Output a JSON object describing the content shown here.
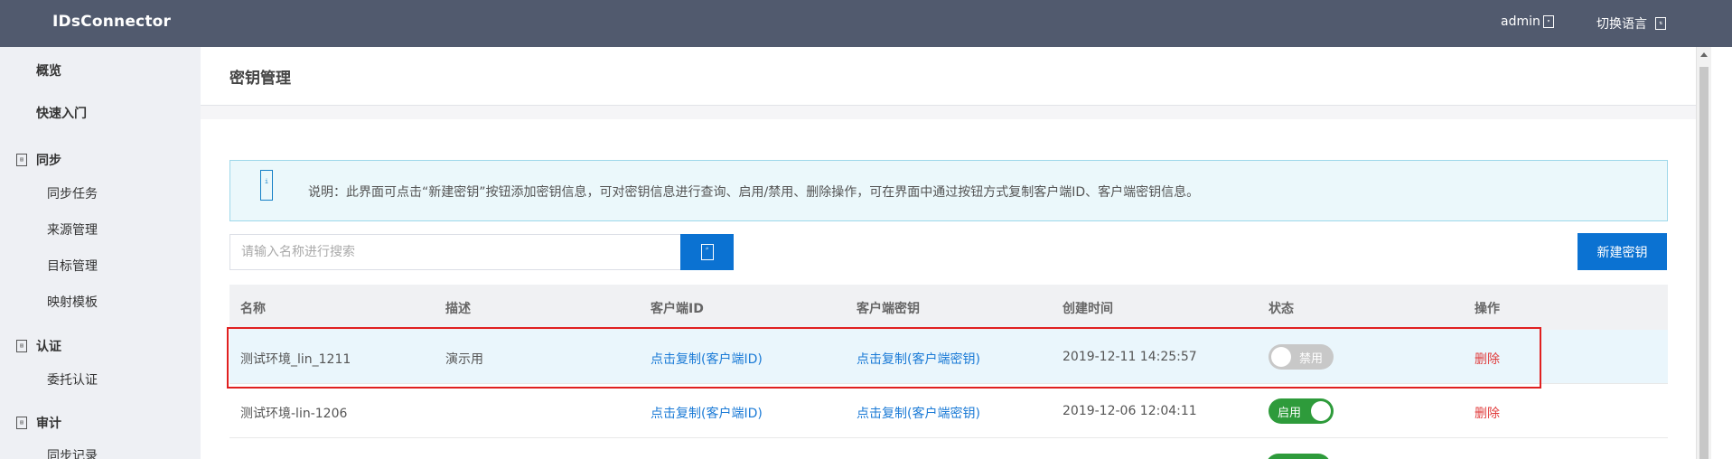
{
  "header": {
    "brand": "IDsConnector",
    "user": "admin",
    "switch_language": "切换语言"
  },
  "sidebar": {
    "overview": "概览",
    "quickstart": "快速入门",
    "groups": [
      {
        "label": "同步",
        "items": [
          "同步任务",
          "来源管理",
          "目标管理",
          "映射模板"
        ]
      },
      {
        "label": "认证",
        "items": [
          "委托认证"
        ]
      },
      {
        "label": "审计",
        "items": [
          "同步记录"
        ]
      }
    ]
  },
  "page": {
    "title": "密钥管理",
    "notice": "说明：此界面可点击“新建密钥”按钮添加密钥信息，可对密钥信息进行查询、启用/禁用、删除操作，可在界面中通过按钮方式复制客户端ID、客户端密钥信息。",
    "search_placeholder": "请输入名称进行搜索",
    "new_key_button": "新建密钥"
  },
  "table": {
    "headers": [
      "名称",
      "描述",
      "客户端ID",
      "客户端密钥",
      "创建时间",
      "状态",
      "操作"
    ],
    "rows": [
      {
        "name": "测试环境_lin_1211",
        "desc": "演示用",
        "client_id": "点击复制(客户端ID)",
        "client_secret": "点击复制(客户端密钥)",
        "created": "2019-12-11 14:25:57",
        "status": "禁用",
        "status_on": false,
        "action": "删除"
      },
      {
        "name": "测试环境-lin-1206",
        "desc": "",
        "client_id": "点击复制(客户端ID)",
        "client_secret": "点击复制(客户端密钥)",
        "created": "2019-12-06 12:04:11",
        "status": "启用",
        "status_on": true,
        "action": "删除"
      }
    ]
  },
  "colors": {
    "header_bg": "#515a6e",
    "primary": "#0b72d2",
    "link": "#1a7ad6",
    "danger": "#e03c3c",
    "switch_on": "#2e9b3b",
    "switch_off": "#c8c8c8",
    "highlight": "#e02020"
  }
}
